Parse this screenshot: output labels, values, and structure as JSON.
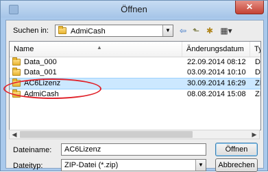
{
  "window": {
    "title": "Öffnen",
    "close_glyph": "✕"
  },
  "lookin": {
    "label": "Suchen in:",
    "folder": "AdmiCash"
  },
  "toolbar": {
    "back_glyph": "⇦",
    "up_glyph": "⬑",
    "newfolder_glyph": "✱",
    "views_glyph": "▦▾"
  },
  "columns": {
    "name": "Name",
    "date": "Änderungsdatum",
    "type": "Ty"
  },
  "files": [
    {
      "name": "Data_000",
      "date": "22.09.2014 08:12",
      "type": "Da"
    },
    {
      "name": "Data_001",
      "date": "03.09.2014 10:10",
      "type": "Da"
    },
    {
      "name": "AC6Lizenz",
      "date": "30.09.2014 16:29",
      "type": "ZI",
      "selected": true
    },
    {
      "name": "AdmiCash",
      "date": "08.08.2014 15:08",
      "type": "ZI"
    }
  ],
  "filename": {
    "label": "Dateiname:",
    "value": "AC6Lizenz"
  },
  "filetype": {
    "label": "Dateityp:",
    "value": "ZIP-Datei (*.zip)"
  },
  "buttons": {
    "open": "Öffnen",
    "cancel": "Abbrechen"
  },
  "annotation": {
    "color": "#e0222a"
  }
}
